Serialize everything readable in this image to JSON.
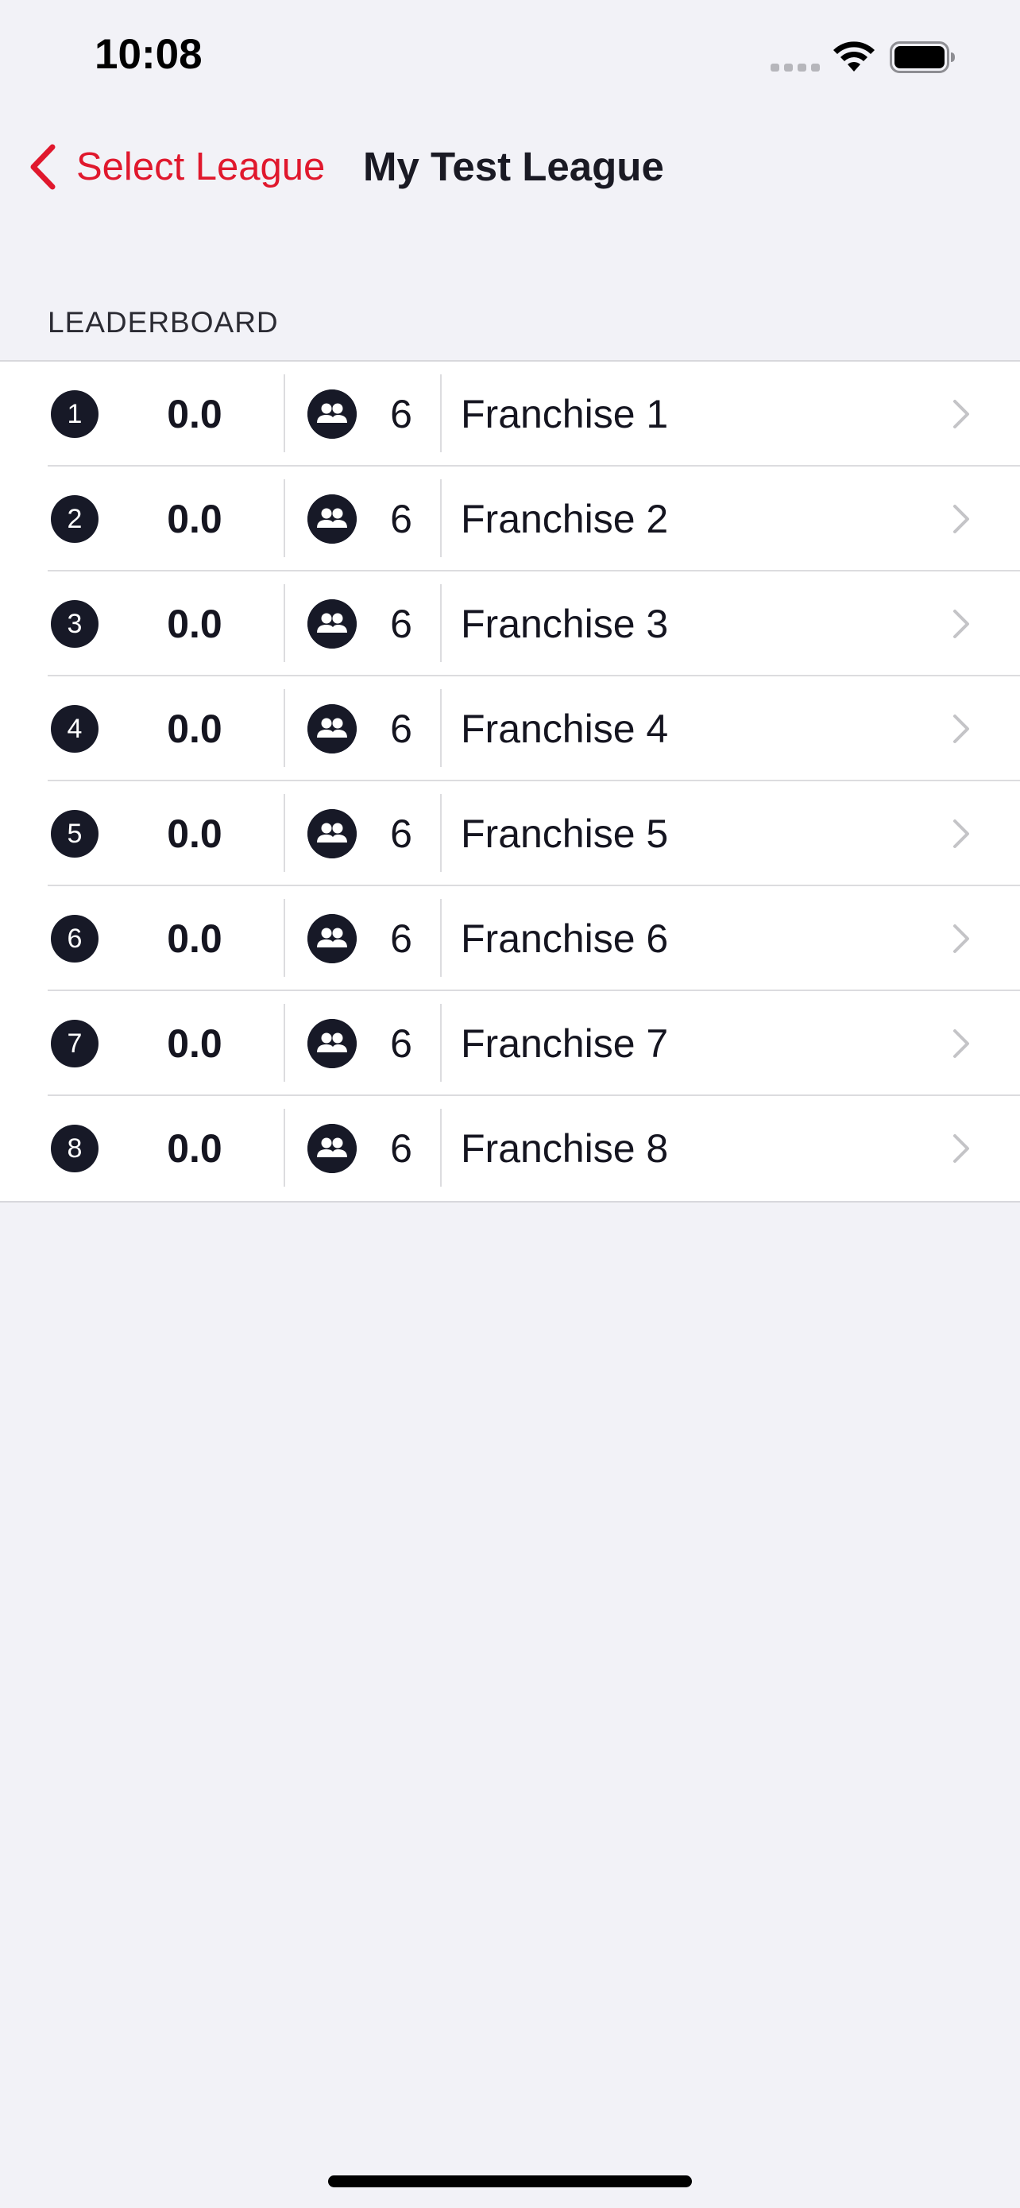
{
  "status_bar": {
    "time": "10:08"
  },
  "nav": {
    "back_label": "Select League",
    "title": "My Test League"
  },
  "leaderboard": {
    "header": "LEADERBOARD",
    "rows": [
      {
        "rank": "1",
        "score": "0.0",
        "members": "6",
        "name": "Franchise 1"
      },
      {
        "rank": "2",
        "score": "0.0",
        "members": "6",
        "name": "Franchise 2"
      },
      {
        "rank": "3",
        "score": "0.0",
        "members": "6",
        "name": "Franchise 3"
      },
      {
        "rank": "4",
        "score": "0.0",
        "members": "6",
        "name": "Franchise 4"
      },
      {
        "rank": "5",
        "score": "0.0",
        "members": "6",
        "name": "Franchise 5"
      },
      {
        "rank": "6",
        "score": "0.0",
        "members": "6",
        "name": "Franchise 6"
      },
      {
        "rank": "7",
        "score": "0.0",
        "members": "6",
        "name": "Franchise 7"
      },
      {
        "rank": "8",
        "score": "0.0",
        "members": "6",
        "name": "Franchise 8"
      }
    ]
  },
  "colors": {
    "accent": "#e0182d",
    "badge": "#171927",
    "background": "#f2f2f7"
  },
  "icons": {
    "back": "chevron-left-icon",
    "members": "people-icon",
    "row_disclosure": "chevron-right-icon"
  }
}
